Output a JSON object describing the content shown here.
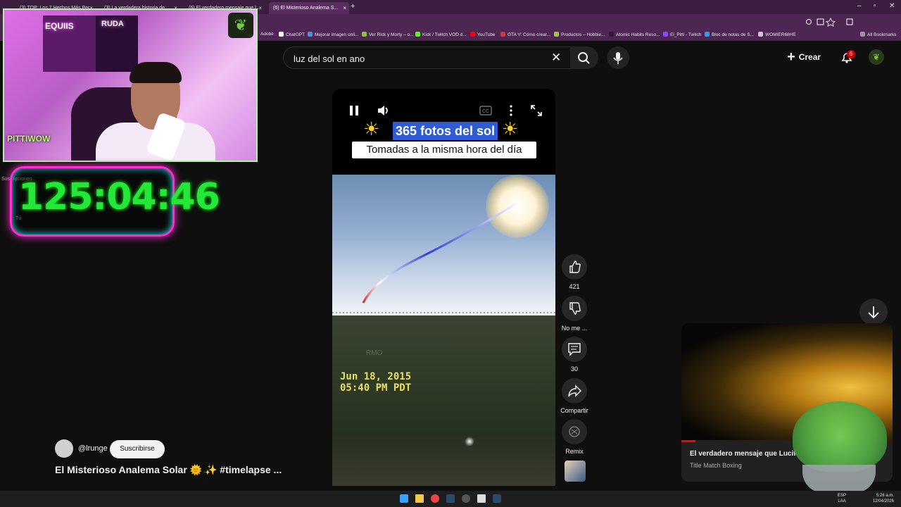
{
  "browser": {
    "tabs": [
      {
        "label": "(3) TOP: Los 7 Hechos Más Per..."
      },
      {
        "label": "(3) La verdadera historia de..."
      },
      {
        "label": "(6) El verdadero mensaje que l..."
      },
      {
        "label": "(6) El Misterioso Analema S..."
      }
    ],
    "bookmarks": [
      "Adobe",
      "ChatGPT",
      "Mejorar imagen onli...",
      "Ver Rick y Morty – o...",
      "Kick / Twitch VOD d...",
      "YouTube",
      "GTA V: Cómo crear...",
      "Productos – Hobbie...",
      "Atomic Habits Reso...",
      "El_Pitti - Twitch",
      "Bloc de notas de S...",
      "WOMIER68HE"
    ],
    "all_bookmarks_label": "All Bookmarks"
  },
  "search": {
    "value": "luz del sol en ano"
  },
  "header": {
    "create_label": "Crear",
    "notifications_count": "6"
  },
  "stream_overlay": {
    "timer": "125:04:46",
    "channel_logo_text": "PITTIWOW",
    "neon_left": "EQUIIS",
    "neon_right": "RUDA"
  },
  "sidebar_hidden": {
    "subs_label": "Suscripciones",
    "you_label": "Tú"
  },
  "short": {
    "banner_title": "365 fotos del sol",
    "banner_subtitle": "Tomadas a la misma hora del día",
    "date_line1": "Jun 18, 2015",
    "date_line2": "05:40 PM PDT",
    "watermark": "RMO",
    "likes": "421",
    "dislike_label": "No me ...",
    "comments": "30",
    "share_label": "Compartir",
    "remix_label": "Remix",
    "channel": "@lrunge",
    "subscribe_label": "Suscribirse",
    "title": "El Misterioso Analema Solar 🌞 ✨ #timelapse ..."
  },
  "miniplayer": {
    "title": "El verdadero mensaje que Lucif",
    "channel": "Title Match Boxing"
  },
  "taskbar": {
    "lang_line1": "ESP",
    "lang_line2": "LAA",
    "time": "5:26 a.m.",
    "date": "12/04/2026"
  },
  "colors": {
    "accent_red": "#ff0000",
    "banner_blue": "#2e5bd6",
    "timer_green": "#23e83a",
    "neon_pink": "#ff2fd0"
  }
}
